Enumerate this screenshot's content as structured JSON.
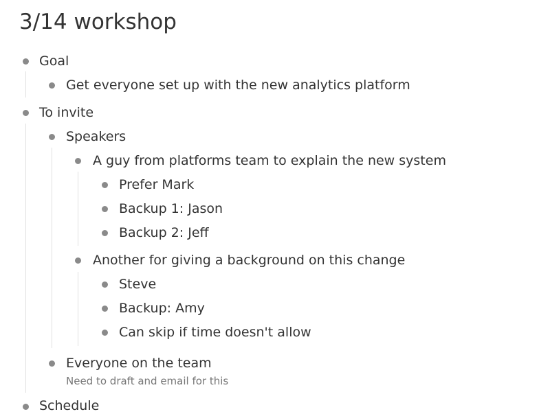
{
  "title": "3/14 workshop",
  "outline": {
    "goal": {
      "label": "Goal",
      "children": [
        "Get everyone set up with the new analytics platform"
      ]
    },
    "to_invite": {
      "label": "To invite",
      "speakers": {
        "label": "Speakers",
        "platforms_guy": {
          "label": "A guy from platforms team to explain the new system",
          "children": [
            "Prefer Mark",
            "Backup 1: Jason",
            "Backup 2: Jeff"
          ]
        },
        "background_speaker": {
          "label": "Another for giving a background on this change",
          "children": [
            "Steve",
            "Backup: Amy",
            "Can skip if time doesn't allow"
          ]
        }
      },
      "everyone": {
        "label": "Everyone on the team",
        "note": "Need to draft and email for this"
      }
    },
    "schedule": {
      "label": "Schedule"
    }
  },
  "colors": {
    "text": "#333333",
    "bullet": "#8a8a8a",
    "note": "#777777",
    "guide": "#e0e0e0"
  }
}
